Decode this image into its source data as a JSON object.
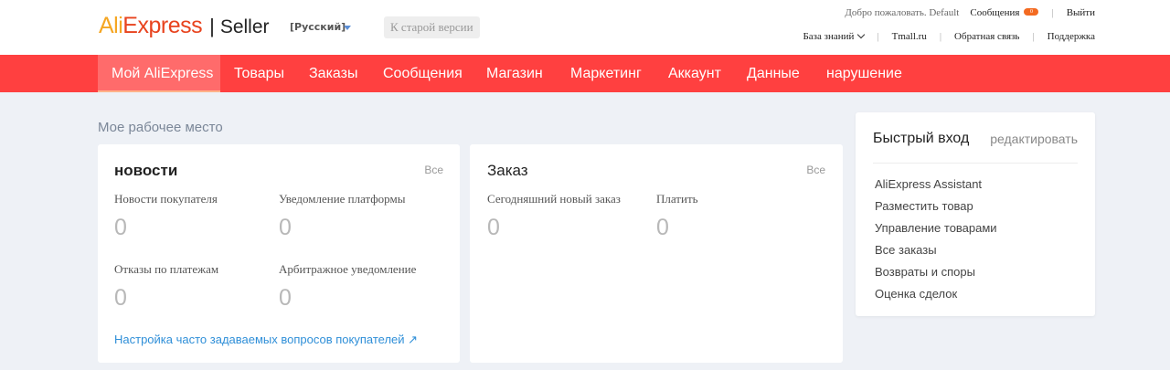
{
  "header": {
    "logo_ali_1": "Ali",
    "logo_ali_2": "Express",
    "logo_sep": "|",
    "logo_seller": "Seller",
    "language": "[Русский]",
    "old_version": "К старой версии",
    "welcome": "Добро пожаловать. Default",
    "messages": "Сообщения",
    "messages_badge": "0",
    "logout": "Выйти",
    "knowledge_base": "База знаний",
    "tmall": "Tmall.ru",
    "feedback": "Обратная связь",
    "support": "Поддержка",
    "separator": "|",
    "brand_color_orange": "#f5a623",
    "brand_color_red": "#e8431e"
  },
  "nav": {
    "items": [
      {
        "label": "Мой AliExpress",
        "active": true
      },
      {
        "label": "Товары"
      },
      {
        "label": "Заказы"
      },
      {
        "label": "Сообщения"
      },
      {
        "label": "Магазин"
      },
      {
        "label": "Маркетинг"
      },
      {
        "label": "Аккаунт"
      },
      {
        "label": "Данные"
      },
      {
        "label": "нарушение"
      }
    ],
    "bg_color": "#ff4040"
  },
  "workspace": {
    "title": "Мое рабочее место",
    "news": {
      "title": "новости",
      "all": "Все",
      "stats": [
        {
          "label": "Новости покупателя",
          "value": "0"
        },
        {
          "label": "Уведомление платформы",
          "value": "0"
        },
        {
          "label": "Отказы по платежам",
          "value": "0"
        },
        {
          "label": "Арбитражное уведомление",
          "value": "0"
        }
      ],
      "faq_link": "Настройка часто задаваемых вопросов покупателей"
    },
    "orders": {
      "title": "Заказ",
      "all": "Все",
      "stats": [
        {
          "label": "Сегодняшний новый заказ",
          "value": "0"
        },
        {
          "label": "Платить",
          "value": "0"
        }
      ]
    }
  },
  "quick_entry": {
    "title": "Быстрый вход",
    "edit": "редактировать",
    "items": [
      "AliExpress Assistant",
      "Разместить товар",
      "Управление товарами",
      "Все заказы",
      "Возвраты и споры",
      "Оценка сделок"
    ]
  }
}
